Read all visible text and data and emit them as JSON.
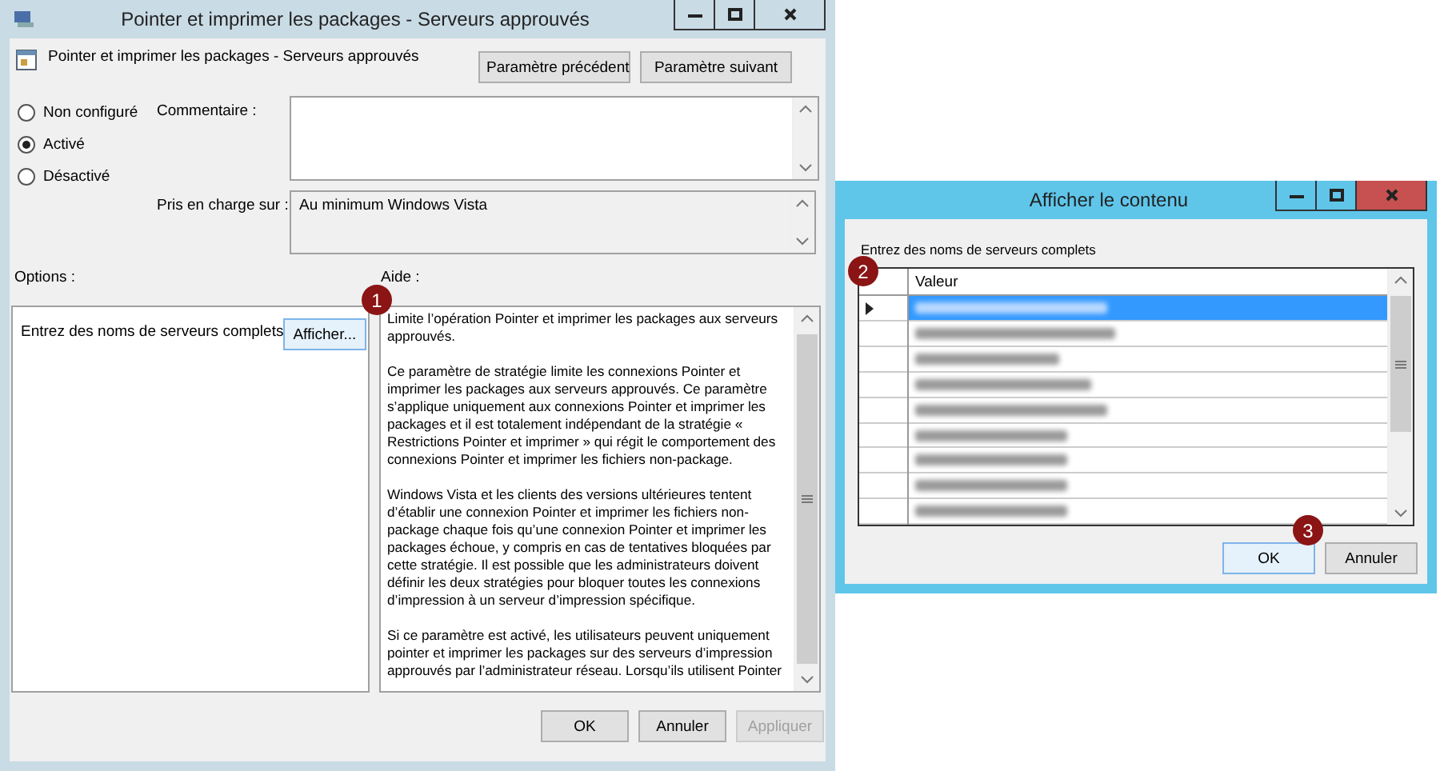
{
  "main_window": {
    "title": "Pointer et imprimer les packages - Serveurs approuvés",
    "policy_title": "Pointer et imprimer les packages - Serveurs approuvés",
    "nav_buttons": [
      "Paramètre précédent",
      "Paramètre suivant"
    ],
    "states": [
      {
        "label": "Non configuré",
        "selected": false
      },
      {
        "label": "Activé",
        "selected": true
      },
      {
        "label": "Désactivé",
        "selected": false
      }
    ],
    "comment": {
      "label": "Commentaire :"
    },
    "supported": {
      "label": "Pris en charge sur :",
      "value": "Au minimum Windows Vista"
    },
    "options": {
      "label": "Options :",
      "option_label": "Entrez des noms de serveurs complets",
      "button": "Afficher..."
    },
    "help": {
      "label": "Aide :",
      "paragraphs": [
        "Limite l’opération Pointer et imprimer les packages aux serveurs approuvés.",
        "Ce paramètre de stratégie limite les connexions Pointer et imprimer les packages aux serveurs approuvés. Ce paramètre s’applique uniquement aux connexions Pointer et imprimer les packages et il est totalement indépendant de la stratégie « Restrictions Pointer et imprimer » qui régit le comportement des connexions Pointer et imprimer les fichiers non-package.",
        "Windows Vista et les clients des versions ultérieures tentent d’établir une connexion Pointer et imprimer les fichiers non-package chaque fois qu’une connexion Pointer et imprimer les packages échoue, y compris en cas de tentatives bloquées par cette stratégie. Il est possible que les administrateurs doivent définir les deux stratégies pour bloquer toutes les connexions d’impression à un serveur d’impression spécifique.",
        "Si ce paramètre est activé, les utilisateurs peuvent uniquement pointer et imprimer les packages sur des serveurs d’impression approuvés par l’administrateur réseau. Lorsqu’ils utilisent Pointer"
      ]
    },
    "buttons": [
      {
        "label": "OK",
        "disabled": false
      },
      {
        "label": "Annuler",
        "disabled": false
      },
      {
        "label": "Appliquer",
        "disabled": true
      }
    ]
  },
  "dialog": {
    "title": "Afficher le contenu",
    "prompt": "Entrez des noms de serveurs complets",
    "column": "Valeur",
    "rows": [
      {
        "selected": true
      },
      {
        "selected": false
      },
      {
        "selected": false
      },
      {
        "selected": false
      },
      {
        "selected": false
      },
      {
        "selected": false
      },
      {
        "selected": false
      },
      {
        "selected": false
      },
      {
        "selected": false
      }
    ],
    "buttons": [
      "OK",
      "Annuler"
    ]
  },
  "callouts": [
    "1",
    "2",
    "3"
  ]
}
